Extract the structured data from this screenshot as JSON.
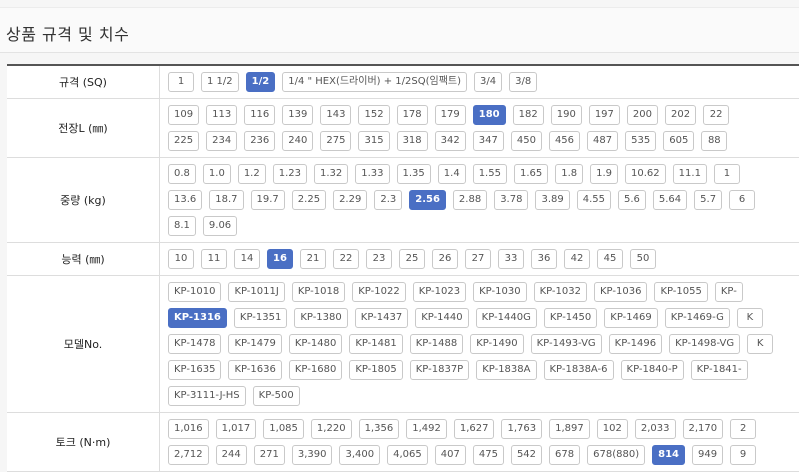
{
  "header": {
    "title": "상품 규격 및 치수"
  },
  "accent_color": "#4a6fc4",
  "rows": [
    {
      "label": "규격 (SQ)",
      "lines": [
        [
          {
            "t": "1"
          },
          {
            "t": "1 1/2"
          },
          {
            "t": "1/2",
            "sel": true
          },
          {
            "t": "1/4 \" HEX(드라이버) + 1/2SQ(임팩트)"
          },
          {
            "t": "3/4"
          },
          {
            "t": "3/8"
          }
        ]
      ]
    },
    {
      "label": "전장L (㎜)",
      "lines": [
        [
          {
            "t": "109"
          },
          {
            "t": "113"
          },
          {
            "t": "116"
          },
          {
            "t": "139"
          },
          {
            "t": "143"
          },
          {
            "t": "152"
          },
          {
            "t": "178"
          },
          {
            "t": "179"
          },
          {
            "t": "180",
            "sel": true
          },
          {
            "t": "182"
          },
          {
            "t": "190"
          },
          {
            "t": "197"
          },
          {
            "t": "200"
          },
          {
            "t": "202"
          },
          {
            "t": "22"
          }
        ],
        [
          {
            "t": "225"
          },
          {
            "t": "234"
          },
          {
            "t": "236"
          },
          {
            "t": "240"
          },
          {
            "t": "275"
          },
          {
            "t": "315"
          },
          {
            "t": "318"
          },
          {
            "t": "342"
          },
          {
            "t": "347"
          },
          {
            "t": "450"
          },
          {
            "t": "456"
          },
          {
            "t": "487"
          },
          {
            "t": "535"
          },
          {
            "t": "605"
          },
          {
            "t": "88"
          }
        ]
      ]
    },
    {
      "label": "중량 (kg)",
      "lines": [
        [
          {
            "t": "0.8"
          },
          {
            "t": "1.0"
          },
          {
            "t": "1.2"
          },
          {
            "t": "1.23"
          },
          {
            "t": "1.32"
          },
          {
            "t": "1.33"
          },
          {
            "t": "1.35"
          },
          {
            "t": "1.4"
          },
          {
            "t": "1.55"
          },
          {
            "t": "1.65"
          },
          {
            "t": "1.8"
          },
          {
            "t": "1.9"
          },
          {
            "t": "10.62"
          },
          {
            "t": "11.1"
          },
          {
            "t": "1"
          }
        ],
        [
          {
            "t": "13.6"
          },
          {
            "t": "18.7"
          },
          {
            "t": "19.7"
          },
          {
            "t": "2.25"
          },
          {
            "t": "2.29"
          },
          {
            "t": "2.3"
          },
          {
            "t": "2.56",
            "sel": true
          },
          {
            "t": "2.88"
          },
          {
            "t": "3.78"
          },
          {
            "t": "3.89"
          },
          {
            "t": "4.55"
          },
          {
            "t": "5.6"
          },
          {
            "t": "5.64"
          },
          {
            "t": "5.7"
          },
          {
            "t": "6"
          }
        ],
        [
          {
            "t": "8.1"
          },
          {
            "t": "9.06"
          }
        ]
      ]
    },
    {
      "label": "능력 (㎜)",
      "lines": [
        [
          {
            "t": "10"
          },
          {
            "t": "11"
          },
          {
            "t": "14"
          },
          {
            "t": "16",
            "sel": true
          },
          {
            "t": "21"
          },
          {
            "t": "22"
          },
          {
            "t": "23"
          },
          {
            "t": "25"
          },
          {
            "t": "26"
          },
          {
            "t": "27"
          },
          {
            "t": "33"
          },
          {
            "t": "36"
          },
          {
            "t": "42"
          },
          {
            "t": "45"
          },
          {
            "t": "50"
          }
        ]
      ]
    },
    {
      "label": "모델No.",
      "lines": [
        [
          {
            "t": "KP-1010"
          },
          {
            "t": "KP-1011J"
          },
          {
            "t": "KP-1018"
          },
          {
            "t": "KP-1022"
          },
          {
            "t": "KP-1023"
          },
          {
            "t": "KP-1030"
          },
          {
            "t": "KP-1032"
          },
          {
            "t": "KP-1036"
          },
          {
            "t": "KP-1055"
          },
          {
            "t": "KP-"
          }
        ],
        [
          {
            "t": "KP-1316",
            "sel": true
          },
          {
            "t": "KP-1351"
          },
          {
            "t": "KP-1380"
          },
          {
            "t": "KP-1437"
          },
          {
            "t": "KP-1440"
          },
          {
            "t": "KP-1440G"
          },
          {
            "t": "KP-1450"
          },
          {
            "t": "KP-1469"
          },
          {
            "t": "KP-1469-G"
          },
          {
            "t": "K"
          }
        ],
        [
          {
            "t": "KP-1478"
          },
          {
            "t": "KP-1479"
          },
          {
            "t": "KP-1480"
          },
          {
            "t": "KP-1481"
          },
          {
            "t": "KP-1488"
          },
          {
            "t": "KP-1490"
          },
          {
            "t": "KP-1493-VG"
          },
          {
            "t": "KP-1496"
          },
          {
            "t": "KP-1498-VG"
          },
          {
            "t": "K"
          }
        ],
        [
          {
            "t": "KP-1635"
          },
          {
            "t": "KP-1636"
          },
          {
            "t": "KP-1680"
          },
          {
            "t": "KP-1805"
          },
          {
            "t": "KP-1837P"
          },
          {
            "t": "KP-1838A"
          },
          {
            "t": "KP-1838A-6"
          },
          {
            "t": "KP-1840-P"
          },
          {
            "t": "KP-1841-"
          }
        ],
        [
          {
            "t": "KP-3111-J-HS"
          },
          {
            "t": "KP-500"
          }
        ]
      ]
    },
    {
      "label": "토크 (N·m)",
      "lines": [
        [
          {
            "t": "1,016"
          },
          {
            "t": "1,017"
          },
          {
            "t": "1,085"
          },
          {
            "t": "1,220"
          },
          {
            "t": "1,356"
          },
          {
            "t": "1,492"
          },
          {
            "t": "1,627"
          },
          {
            "t": "1,763"
          },
          {
            "t": "1,897"
          },
          {
            "t": "102"
          },
          {
            "t": "2,033"
          },
          {
            "t": "2,170"
          },
          {
            "t": "2"
          }
        ],
        [
          {
            "t": "2,712"
          },
          {
            "t": "244"
          },
          {
            "t": "271"
          },
          {
            "t": "3,390"
          },
          {
            "t": "3,400"
          },
          {
            "t": "4,065"
          },
          {
            "t": "407"
          },
          {
            "t": "475"
          },
          {
            "t": "542"
          },
          {
            "t": "678"
          },
          {
            "t": "678(880)"
          },
          {
            "t": "814",
            "sel": true
          },
          {
            "t": "949"
          },
          {
            "t": "9"
          }
        ]
      ]
    }
  ]
}
